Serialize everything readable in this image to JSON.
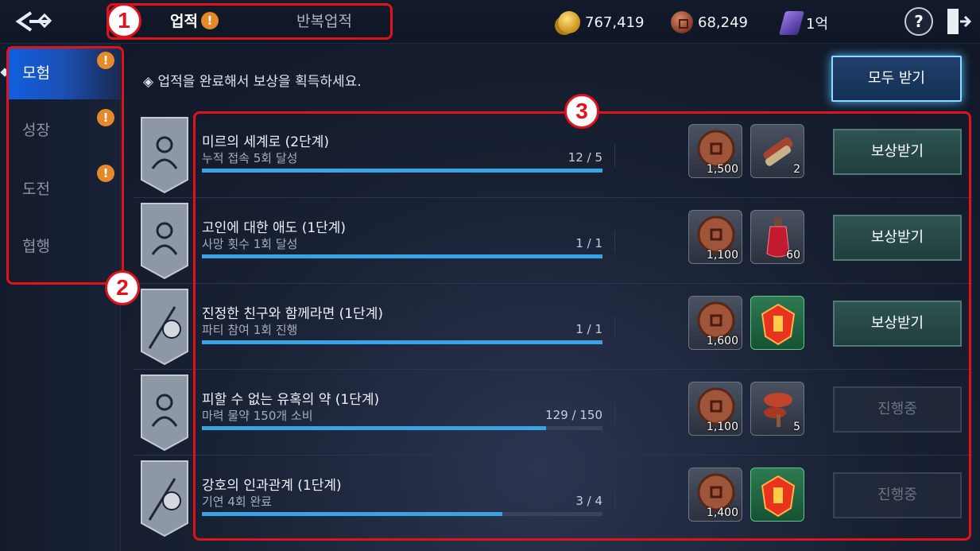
{
  "topbar": {
    "tabs": [
      {
        "label": "업적",
        "alert": "!"
      },
      {
        "label": "반복업적"
      }
    ],
    "currencies": [
      {
        "icon": "gold-coins-icon",
        "value": "767,419"
      },
      {
        "icon": "copper-coin-icon",
        "value": "68,249"
      },
      {
        "icon": "purple-gem-icon",
        "value": "1억"
      }
    ],
    "help_label": "?"
  },
  "annotations": [
    "1",
    "2",
    "3"
  ],
  "sidebar": {
    "items": [
      {
        "label": "모험",
        "alert": "!"
      },
      {
        "label": "성장",
        "alert": "!"
      },
      {
        "label": "도전",
        "alert": "!"
      },
      {
        "label": "협행"
      }
    ]
  },
  "header": {
    "info": "◈ 업적을 완료해서 보상을 획득하세요.",
    "claim_all": "모두 받기"
  },
  "achievements": [
    {
      "badge": "hooded-figure-icon",
      "title": "미르의 세계로 (2단계)",
      "desc": "누적 접속 5회 달성",
      "progress": "12 / 5",
      "ratio": 1.0,
      "rewards": [
        {
          "icon": "copper-coin-icon",
          "count": "1,500"
        },
        {
          "icon": "scroll-bundle-icon",
          "count": "2"
        }
      ],
      "button": "보상받기",
      "claimable": true
    },
    {
      "badge": "hooded-figure-icon",
      "title": "고인에 대한 애도 (1단계)",
      "desc": "사망 횟수 1회 달성",
      "progress": "1 / 1",
      "ratio": 1.0,
      "rewards": [
        {
          "icon": "copper-coin-icon",
          "count": "1,100"
        },
        {
          "icon": "red-potion-icon",
          "count": "60"
        }
      ],
      "button": "보상받기",
      "claimable": true
    },
    {
      "badge": "bindle-icon",
      "title": "진정한 친구와 함께라면 (1단계)",
      "desc": "파티 참여 1회 진행",
      "progress": "1 / 1",
      "ratio": 1.0,
      "rewards": [
        {
          "icon": "copper-coin-icon",
          "count": "1,600"
        },
        {
          "icon": "red-crystal-icon",
          "count": ""
        }
      ],
      "button": "보상받기",
      "claimable": true
    },
    {
      "badge": "hooded-figure-icon",
      "title": "피할 수 없는 유혹의 약 (1단계)",
      "desc": "마력 물약 150개 소비",
      "progress": "129 / 150",
      "ratio": 0.86,
      "rewards": [
        {
          "icon": "copper-coin-icon",
          "count": "1,100"
        },
        {
          "icon": "mushroom-icon",
          "count": "5"
        }
      ],
      "button": "진행중",
      "claimable": false
    },
    {
      "badge": "bindle-icon",
      "title": "강호의 인과관계 (1단계)",
      "desc": "기연 4회 완료",
      "progress": "3 / 4",
      "ratio": 0.75,
      "rewards": [
        {
          "icon": "copper-coin-icon",
          "count": "1,400"
        },
        {
          "icon": "red-crystal-icon",
          "count": ""
        }
      ],
      "button": "진행중",
      "claimable": false
    }
  ],
  "colors": {
    "accent": "#3aa3e6",
    "alert": "#e58a2a",
    "annotation": "#e0121c"
  }
}
